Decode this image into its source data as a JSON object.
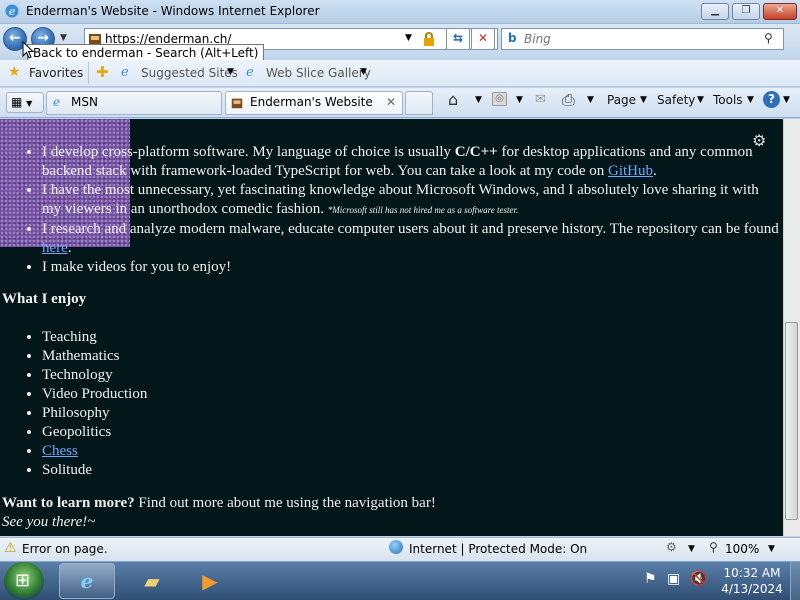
{
  "window": {
    "title": "Enderman's Website - Windows Internet Explorer"
  },
  "nav": {
    "address": "https://enderman.ch/",
    "search_placeholder": "Bing",
    "back_tooltip": "Back to enderman - Search (Alt+Left)"
  },
  "favorites": {
    "favorites_label": "Favorites",
    "suggested_label": "Suggested Sites",
    "webslice_label": "Web Slice Gallery"
  },
  "tabs": [
    {
      "label": "MSN"
    },
    {
      "label": "Enderman's Website"
    }
  ],
  "commands": {
    "page": "Page",
    "safety": "Safety",
    "tools": "Tools"
  },
  "content": {
    "bullets1": [
      {
        "pre": "I develop cross-platform software. My language of choice is usually ",
        "bold": "C/C++",
        "mid": " for desktop applications and any common backend stack with framework-loaded TypeScript for web. You can take a look at my code on ",
        "link": "GitHub",
        "post": "."
      },
      {
        "text": "I have the most unnecessary, yet fascinating knowledge about Microsoft Windows, and I absolutely love sharing it with my viewers in an unorthodox comedic fashion.",
        "note": "*Microsoft still has not hired me as a software tester."
      },
      {
        "text": "I research and analyze modern malware, educate computer users about it and preserve history. The repository can be found ",
        "link": "here",
        "post": "."
      },
      {
        "text": "I make videos for you to enjoy!"
      }
    ],
    "enjoy_heading": "What I enjoy",
    "enjoy_items": [
      "Teaching",
      "Mathematics",
      "Technology",
      "Video Production",
      "Philosophy",
      "Geopolitics",
      "Chess",
      "Solitude"
    ],
    "learn_bold": "Want to learn more?",
    "learn_rest": " Find out more about me using the navigation bar!",
    "see_you": "See you there!~"
  },
  "status": {
    "error_text": "Error on page.",
    "zone_text": "Internet | Protected Mode: On",
    "zoom": "100%"
  },
  "taskbar": {
    "time": "10:32 AM",
    "date": "4/13/2024"
  },
  "colors": {
    "page_bg": "#03171a",
    "link": "#6ea8ff",
    "noise": "#7a56a8"
  }
}
